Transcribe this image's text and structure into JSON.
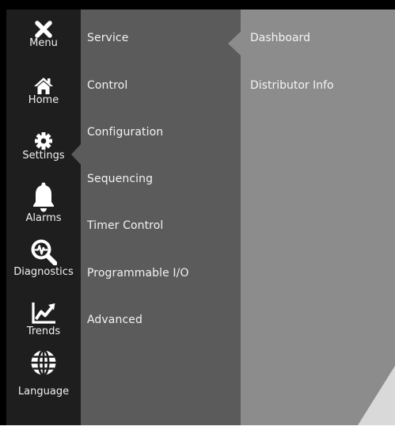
{
  "rail": {
    "items": [
      {
        "label": "Menu",
        "icon": "close-icon"
      },
      {
        "label": "Home",
        "icon": "home-icon"
      },
      {
        "label": "Settings",
        "icon": "gear-icon"
      },
      {
        "label": "Alarms",
        "icon": "bell-icon"
      },
      {
        "label": "Diagnostics",
        "icon": "diagnostics-magnifier-icon"
      },
      {
        "label": "Trends",
        "icon": "trend-chart-icon"
      },
      {
        "label": "Language",
        "icon": "globe-icon"
      }
    ],
    "selected": "Settings"
  },
  "menu": {
    "items": [
      {
        "label": "Service"
      },
      {
        "label": "Control"
      },
      {
        "label": "Configuration"
      },
      {
        "label": "Sequencing"
      },
      {
        "label": "Timer Control"
      },
      {
        "label": "Programmable I/O"
      },
      {
        "label": "Advanced"
      }
    ],
    "selected": "Service"
  },
  "submenu": {
    "items": [
      {
        "label": "Dashboard"
      },
      {
        "label": "Distributor Info"
      }
    ]
  },
  "colors": {
    "rail_bg": "#1e1e1e",
    "menu_bg": "#5b5b5b",
    "submenu_bg": "#8c8c8c",
    "frame": "#000000",
    "text": "#f2f2f2"
  }
}
